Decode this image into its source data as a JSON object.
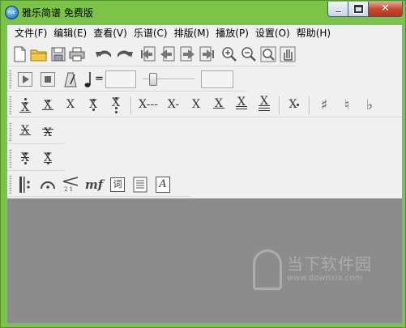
{
  "window": {
    "title": "雅乐简谱 免费版",
    "app_icon_text": "YUE"
  },
  "caption_buttons": {
    "close": "✕"
  },
  "menu": [
    "文件(F)",
    "编辑(E)",
    "查看(V)",
    "乐谱(C)",
    "排版(M)",
    "播放(P)",
    "设置(O)",
    "帮助(H)"
  ],
  "playback": {
    "tempo_equals": "=",
    "tempo_value": "",
    "position_value": "",
    "tempo_fraction": 0.15
  },
  "notes": {
    "x": "X",
    "x_dash3": "X---",
    "x_dash1": "X-"
  },
  "accidentals": {
    "sharp": "♯",
    "natural": "♮",
    "flat": "♭"
  },
  "expression": {
    "mf": "mf",
    "lyric": "词",
    "text_a": "A",
    "tuplet": "2 1"
  },
  "watermark": {
    "text": "当下软件园",
    "url": "www.downxia.com"
  },
  "colors": {
    "frame": "#7cc447",
    "workspace": "#8c8c8c",
    "close_button": "#c74a32"
  }
}
